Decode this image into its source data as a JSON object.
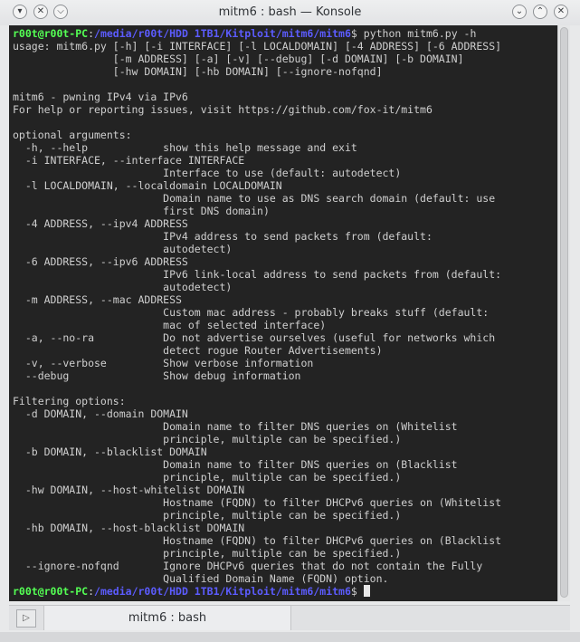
{
  "window": {
    "title": "mitm6 : bash — Konsole"
  },
  "titlebar_icons": [
    "chevron-down-icon",
    "pin-icon",
    "chevron-down-icon",
    "chevron-up-icon",
    "close-icon"
  ],
  "prompt": {
    "user": "r00t@r00t-PC",
    "sep": ":",
    "path": "/media/r00t/HDD 1TB1/Kitploit/mitm6/mitm6",
    "symbol": "$",
    "command": " python mitm6.py -h"
  },
  "output_lines": [
    "usage: mitm6.py [-h] [-i INTERFACE] [-l LOCALDOMAIN] [-4 ADDRESS] [-6 ADDRESS]",
    "                [-m ADDRESS] [-a] [-v] [--debug] [-d DOMAIN] [-b DOMAIN]",
    "                [-hw DOMAIN] [-hb DOMAIN] [--ignore-nofqnd]",
    "",
    "mitm6 - pwning IPv4 via IPv6",
    "For help or reporting issues, visit https://github.com/fox-it/mitm6",
    "",
    "optional arguments:",
    "  -h, --help            show this help message and exit",
    "  -i INTERFACE, --interface INTERFACE",
    "                        Interface to use (default: autodetect)",
    "  -l LOCALDOMAIN, --localdomain LOCALDOMAIN",
    "                        Domain name to use as DNS search domain (default: use",
    "                        first DNS domain)",
    "  -4 ADDRESS, --ipv4 ADDRESS",
    "                        IPv4 address to send packets from (default:",
    "                        autodetect)",
    "  -6 ADDRESS, --ipv6 ADDRESS",
    "                        IPv6 link-local address to send packets from (default:",
    "                        autodetect)",
    "  -m ADDRESS, --mac ADDRESS",
    "                        Custom mac address - probably breaks stuff (default:",
    "                        mac of selected interface)",
    "  -a, --no-ra           Do not advertise ourselves (useful for networks which",
    "                        detect rogue Router Advertisements)",
    "  -v, --verbose         Show verbose information",
    "  --debug               Show debug information",
    "",
    "Filtering options:",
    "  -d DOMAIN, --domain DOMAIN",
    "                        Domain name to filter DNS queries on (Whitelist",
    "                        principle, multiple can be specified.)",
    "  -b DOMAIN, --blacklist DOMAIN",
    "                        Domain name to filter DNS queries on (Blacklist",
    "                        principle, multiple can be specified.)",
    "  -hw DOMAIN, --host-whitelist DOMAIN",
    "                        Hostname (FQDN) to filter DHCPv6 queries on (Whitelist",
    "                        principle, multiple can be specified.)",
    "  -hb DOMAIN, --host-blacklist DOMAIN",
    "                        Hostname (FQDN) to filter DHCPv6 queries on (Blacklist",
    "                        principle, multiple can be specified.)",
    "  --ignore-nofqnd       Ignore DHCPv6 queries that do not contain the Fully",
    "                        Qualified Domain Name (FQDN) option."
  ],
  "tabs": [
    {
      "label": "mitm6 : bash"
    }
  ],
  "colors": {
    "terminal_bg": "#232323",
    "text": "#cfcfcf",
    "prompt_user": "#54ff54",
    "prompt_path": "#5c5cff"
  }
}
